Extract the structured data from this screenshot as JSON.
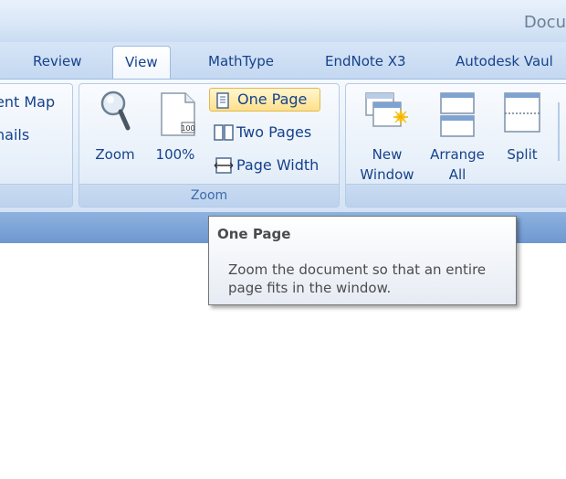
{
  "window": {
    "title": "Docu"
  },
  "tabs": [
    {
      "label": "Review",
      "active": false
    },
    {
      "label": "View",
      "active": true
    },
    {
      "label": "MathType",
      "active": false
    },
    {
      "label": "EndNote X3",
      "active": false
    },
    {
      "label": "Autodesk Vaul",
      "active": false
    }
  ],
  "show_hide_group": {
    "items": [
      "ent Map",
      "nails"
    ]
  },
  "zoom_group": {
    "label": "Zoom",
    "zoom_label": "Zoom",
    "hundred_label": "100%",
    "hundred_icon_text": "100",
    "one_page_label": "One Page",
    "two_pages_label": "Two Pages",
    "page_width_label": "Page Width"
  },
  "window_group": {
    "new_window_line1": "New",
    "new_window_line2": "Window",
    "arrange_all_line1": "Arrange",
    "arrange_all_line2": "All",
    "split_label": "Split"
  },
  "tooltip": {
    "title": "One Page",
    "body": "Zoom the document so that an entire page fits in the window."
  },
  "colors": {
    "tab_text": "#15428b",
    "group_label": "#3e6aaa",
    "highlight": "#ffe08a",
    "ribbon_bottom": "#7aa1d6"
  }
}
